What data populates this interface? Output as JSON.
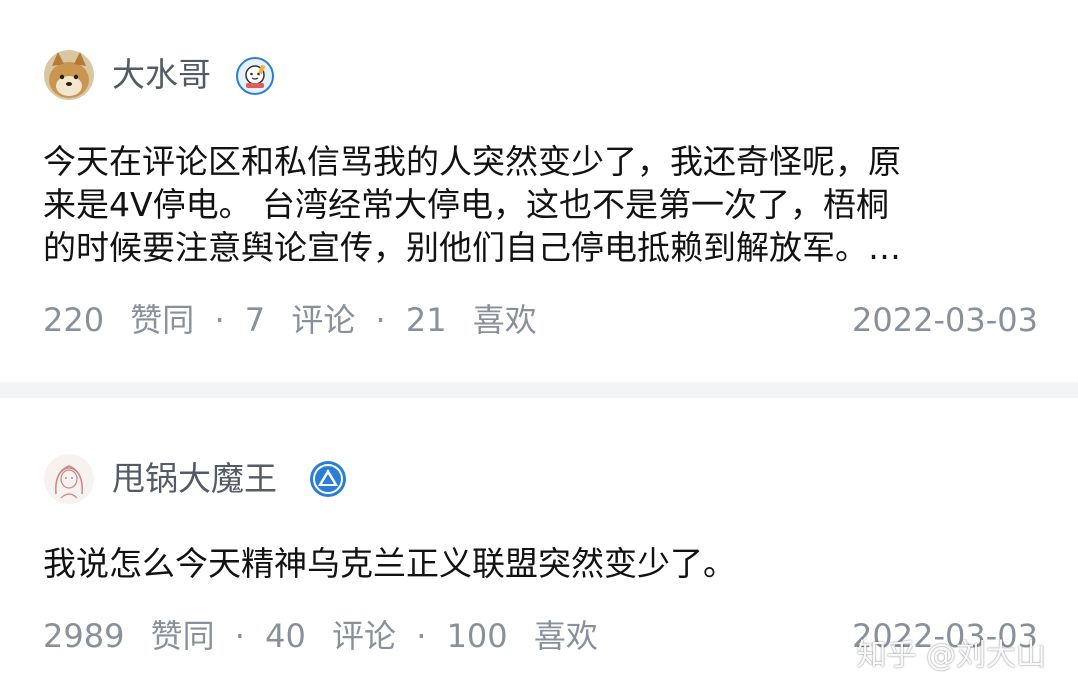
{
  "posts": [
    {
      "author": "大水哥",
      "content_lines": [
        "今天在评论区和私信骂我的人突然变少了，我还奇怪呢，原",
        "来是4V停电。 台湾经常大停电，这也不是第一次了，梧桐",
        "的时候要注意舆论宣传，别他们自己停电抵赖到解放军。…"
      ],
      "likes": "220",
      "likes_label": "赞同",
      "comments": "7",
      "comments_label": "评论",
      "favorites": "21",
      "favorites_label": "喜欢",
      "date": "2022-03-03",
      "separator": "·"
    },
    {
      "author": "甩锅大魔王",
      "content_lines": [
        "我说怎么今天精神乌克兰正义联盟突然变少了。"
      ],
      "likes": "2989",
      "likes_label": "赞同",
      "comments": "40",
      "comments_label": "评论",
      "favorites": "100",
      "favorites_label": "喜欢",
      "date": "2022-03-03",
      "separator": "·"
    }
  ],
  "watermark": "知乎 @刘大山",
  "colors": {
    "author": "#555b66",
    "content": "#121212",
    "meta": "#8a909b",
    "divider": "#f3f4f6",
    "badge_blue": "#2a7fd4"
  },
  "icons": {
    "post1_badge": "cartoon-creator-badge-icon",
    "post2_badge": "blue-triangle-badge-icon"
  }
}
